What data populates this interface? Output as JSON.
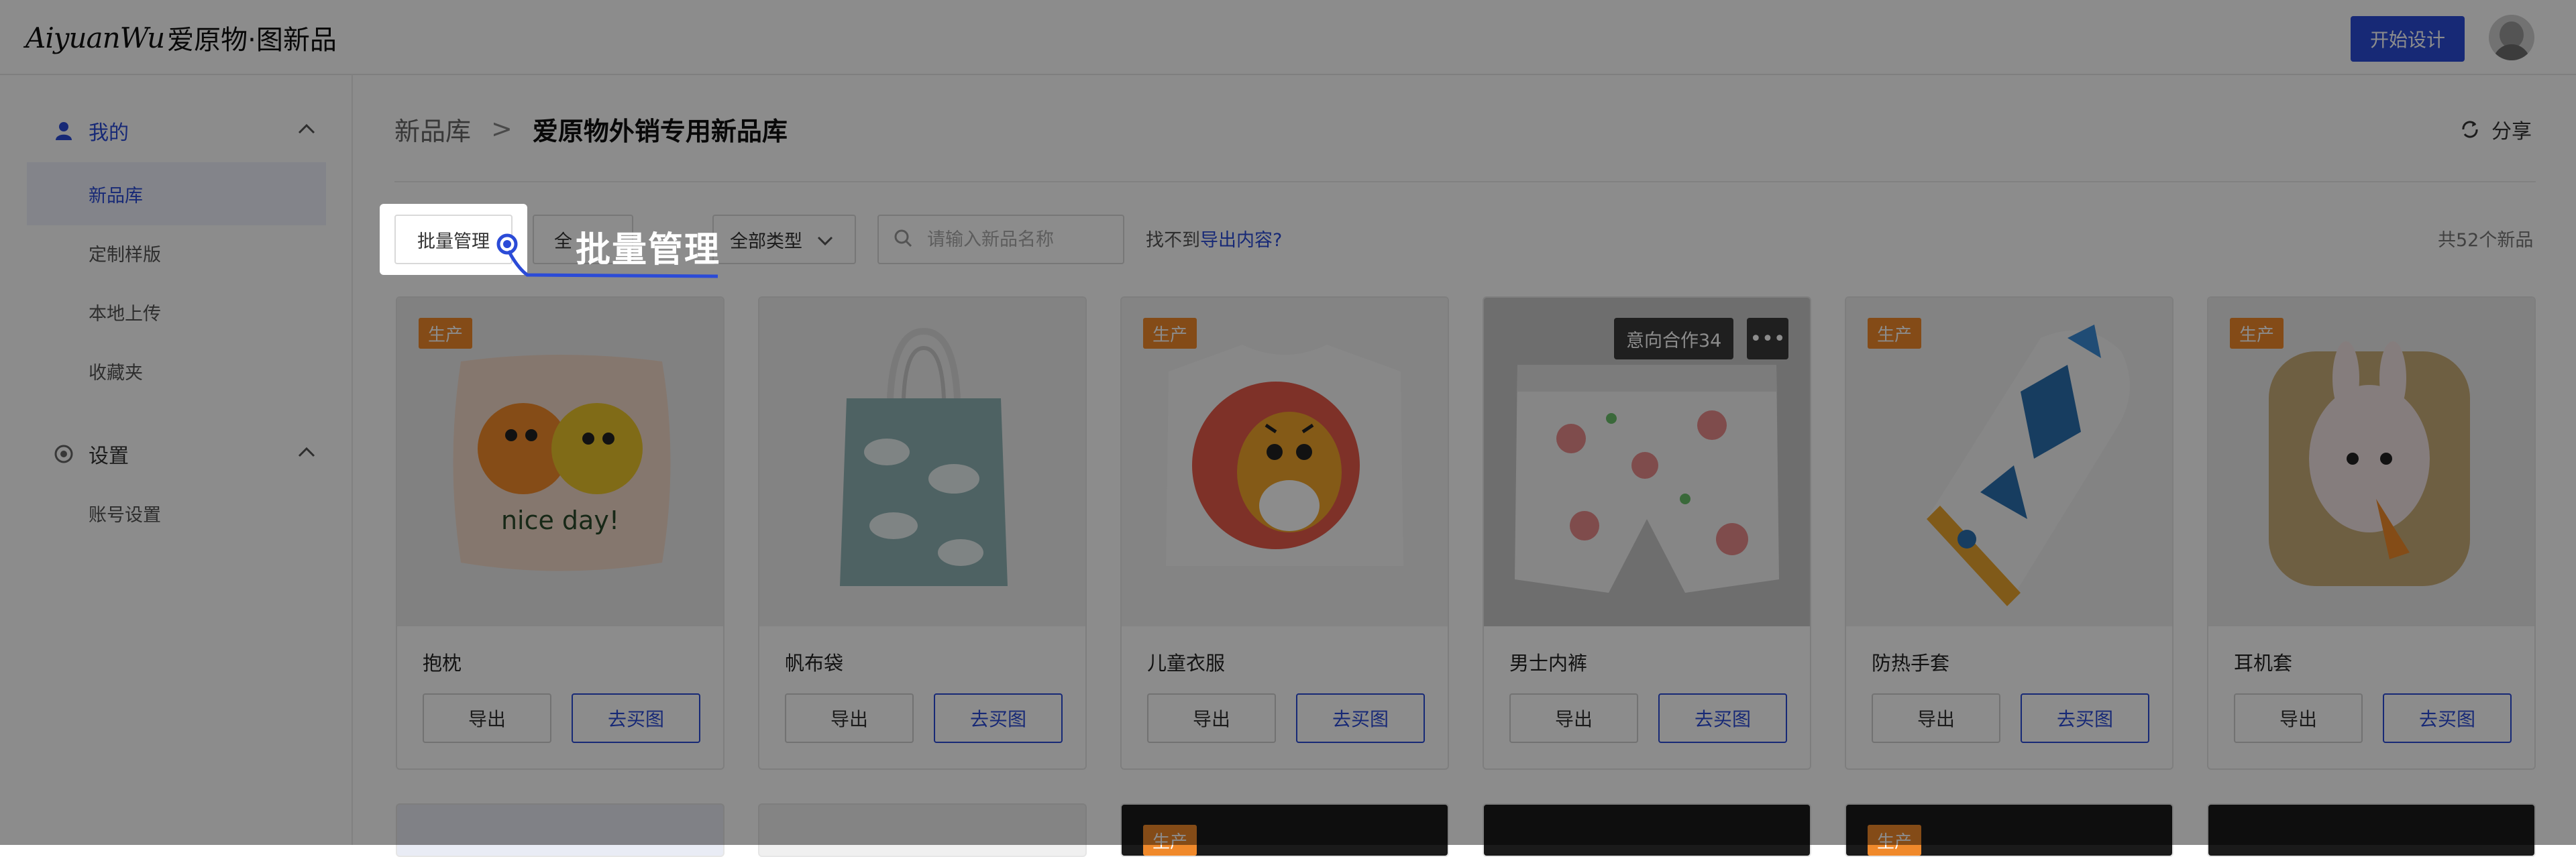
{
  "header": {
    "logo_en": "AiyuanWu",
    "logo_cn": "爱原物·图新品",
    "start_design": "开始设计"
  },
  "sidebar": {
    "sections": [
      {
        "label": "我的",
        "icon": "user-icon",
        "items": [
          {
            "label": "新品库",
            "active": true
          },
          {
            "label": "定制样版",
            "active": false
          },
          {
            "label": "本地上传",
            "active": false
          },
          {
            "label": "收藏夹",
            "active": false
          }
        ]
      },
      {
        "label": "设置",
        "icon": "settings-icon",
        "items": [
          {
            "label": "账号设置",
            "active": false
          }
        ]
      }
    ]
  },
  "breadcrumb": {
    "root": "新品库",
    "separator": ">",
    "current": "爱原物外销专用新品库"
  },
  "share_label": "分享",
  "toolbar": {
    "batch_manage": "批量管理",
    "filter_a": "全",
    "filter_b": "全部类型",
    "search_placeholder": "请输入新品名称",
    "not_found_prefix": "找不到",
    "not_found_link": "导出内容?",
    "total": "共52个新品"
  },
  "tour": {
    "label": "批量管理"
  },
  "card_buttons": {
    "export": "导出",
    "buy": "去买图"
  },
  "products": [
    {
      "name": "抱枕",
      "badge": "生产"
    },
    {
      "name": "帆布袋",
      "badge": ""
    },
    {
      "name": "儿童衣服",
      "badge": "生产"
    },
    {
      "name": "男士内裤",
      "badge": "",
      "coop": "意向合作34",
      "more": "•••"
    },
    {
      "name": "防热手套",
      "badge": "生产"
    },
    {
      "name": "耳机套",
      "badge": "生产"
    }
  ],
  "second_row_badges": [
    "",
    "",
    "生产",
    "",
    "生产",
    ""
  ],
  "colors": {
    "primary": "#2b4bd7",
    "badge": "#f0892b",
    "overlay": "rgba(0,0,0,0.45)"
  }
}
